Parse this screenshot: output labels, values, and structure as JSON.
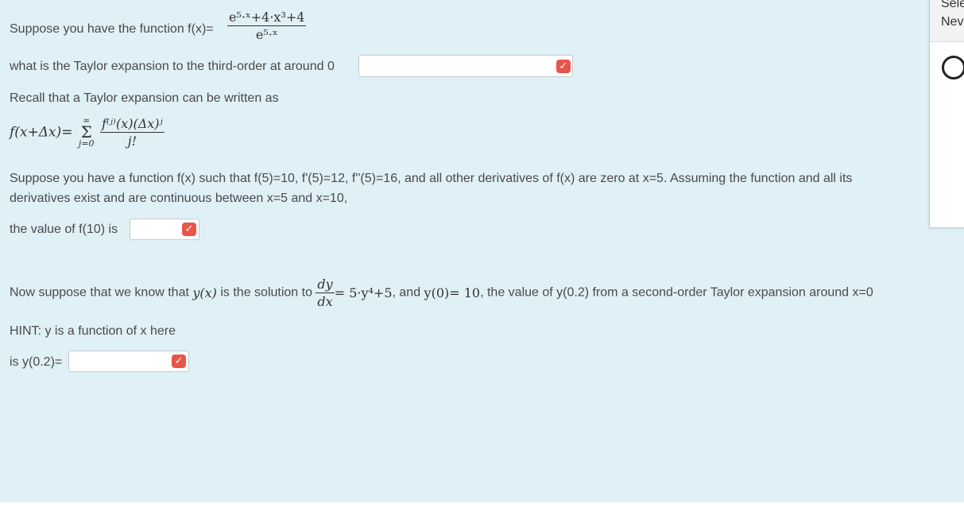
{
  "q1": {
    "prefix": "Suppose you have the function f(x)=",
    "numerator": "e⁵·ˣ+4·x³+4",
    "denominator": "e⁵·ˣ",
    "question": "what is the Taylor expansion to the third-order at around 0",
    "answer_value": "",
    "check_icon": "check-icon"
  },
  "recall": {
    "text": "Recall that a Taylor expansion can be written as",
    "formula_lhs": "f(x+Δx)=",
    "sum_sup": "∞",
    "sum_sym": "Σ",
    "sum_sub": "j=0",
    "frac_top": "f⁽ʲ⁾(x)(Δx)ʲ",
    "frac_bot": "j!"
  },
  "q2": {
    "line1": "Suppose you have a function f(x) such that f(5)=10, f'(5)=12, f''(5)=16, and all other derivatives of f(x) are zero at x=5. Assuming the function and all its",
    "line2": "derivatives exist and are continuous between x=5 and x=10,",
    "prompt": "the value of f(10) is",
    "answer_value": ""
  },
  "q3": {
    "pre": "Now suppose that  we know that ",
    "yx": "y(x)",
    "mid": " is the solution to ",
    "dy": "dy",
    "dx": "dx",
    "rhs": "= 5·y⁴+5",
    "post1": ", and ",
    "y0": "y(0)= 10",
    "post2": ", the value of y(0.2) from a second-order Taylor expansion around x=0",
    "hint": "HINT: y is a function of x here",
    "prompt": "is y(0.2)=",
    "answer_value": ""
  },
  "side_panel": {
    "line1": "Sele",
    "line2": "Nev",
    "icon": "profile-icon"
  }
}
